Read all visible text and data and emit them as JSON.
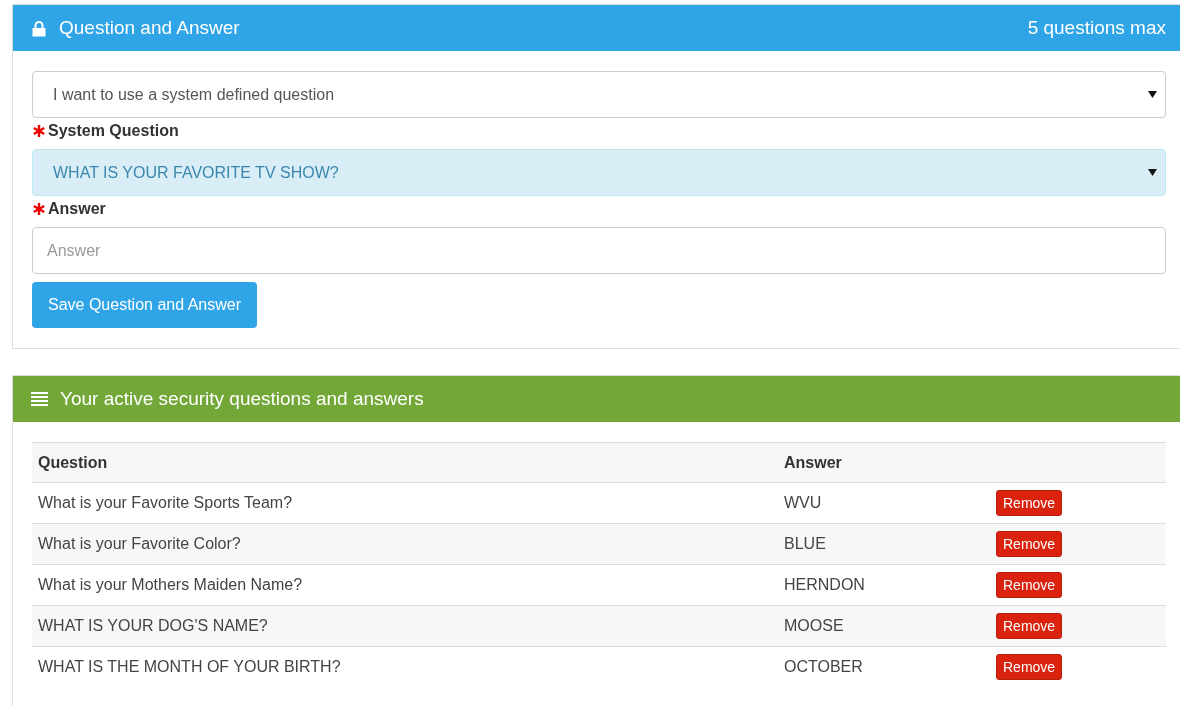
{
  "qa_panel": {
    "title": "Question and Answer",
    "info": "5 questions max",
    "mode_select": {
      "value": "I want to use a system defined question",
      "highlighted": false
    },
    "fields": [
      {
        "kind": "select",
        "label": "System Question",
        "required": true,
        "value": "WHAT IS YOUR FAVORITE TV SHOW?",
        "highlighted": true
      },
      {
        "kind": "input",
        "label": "Answer",
        "required": true,
        "placeholder": "Answer"
      }
    ],
    "save_button": "Save Question and Answer"
  },
  "active_panel": {
    "title": "Your active security questions and answers",
    "table": {
      "columns": [
        "Question",
        "Answer"
      ],
      "rows": [
        {
          "question": "What is your Favorite Sports Team?",
          "answer": "WVU",
          "action": "Remove"
        },
        {
          "question": "What is your Favorite Color?",
          "answer": "BLUE",
          "action": "Remove"
        },
        {
          "question": "What is your Mothers Maiden Name?",
          "answer": "HERNDON",
          "action": "Remove"
        },
        {
          "question": "WHAT IS YOUR DOG'S NAME?",
          "answer": "MOOSE",
          "action": "Remove"
        },
        {
          "question": "WHAT IS THE MONTH OF YOUR BIRTH?",
          "answer": "OCTOBER",
          "action": "Remove"
        }
      ]
    }
  }
}
